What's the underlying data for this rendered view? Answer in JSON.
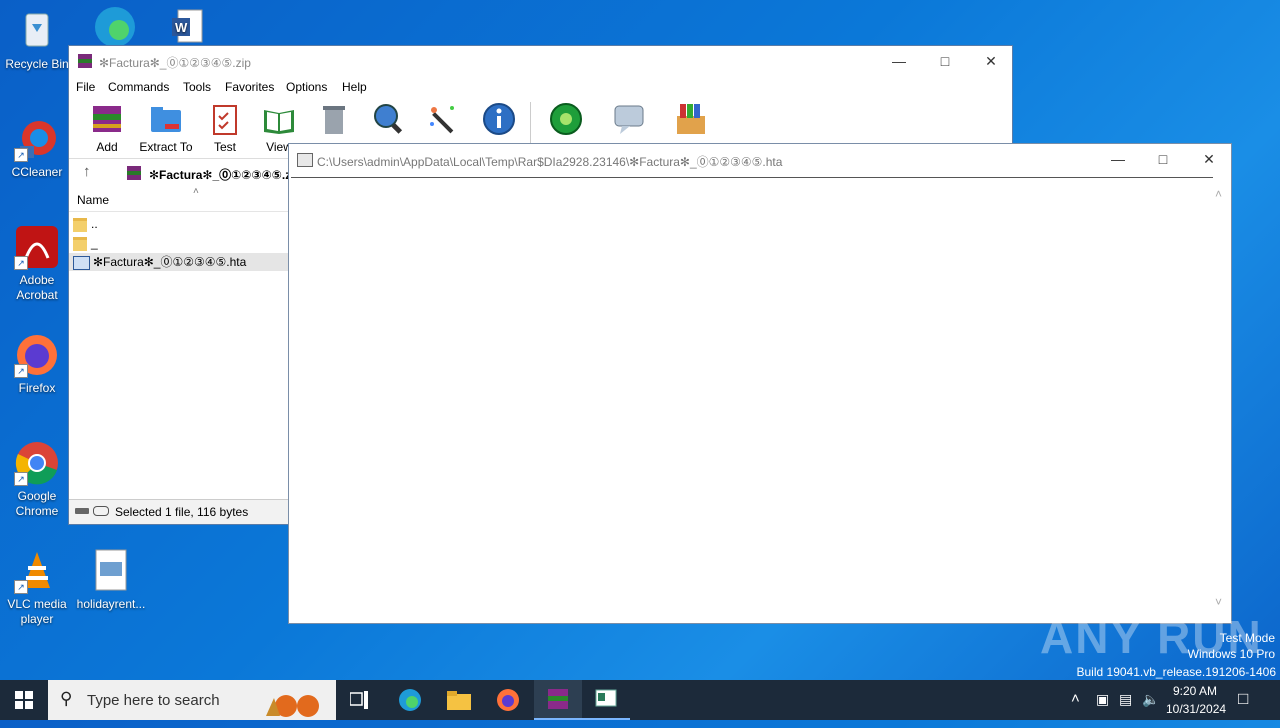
{
  "desktop": {
    "icons": [
      {
        "label": "Recycle Bin",
        "icon": "recycle-bin-icon"
      },
      {
        "label": "CCleaner",
        "icon": "ccleaner-icon"
      },
      {
        "label": "Adobe Acrobat",
        "icon": "acrobat-icon"
      },
      {
        "label": "Firefox",
        "icon": "firefox-icon"
      },
      {
        "label": "Google Chrome",
        "icon": "chrome-icon"
      },
      {
        "label": "VLC media player",
        "icon": "vlc-icon"
      },
      {
        "label": "holidayrent...",
        "icon": "file-icon"
      }
    ]
  },
  "winrar": {
    "title": "✻Factura✻_⓪①②③④⑤.zip",
    "menu": [
      "File",
      "Commands",
      "Tools",
      "Favorites",
      "Options",
      "Help"
    ],
    "toolbar": [
      "Add",
      "Extract To",
      "Test",
      "View",
      "Delete",
      "Find",
      "Wizard",
      "Info",
      "VirusScan",
      "Comment",
      "SFX"
    ],
    "address": "✻Factura✻_⓪①②③④⑤.z",
    "column_name": "Name",
    "rows": [
      "..",
      "_",
      "✻Factura✻_⓪①②③④⑤.hta"
    ],
    "status": "Selected 1 file, 116 bytes"
  },
  "hta": {
    "title": "C:\\Users\\admin\\AppData\\Local\\Temp\\Rar$DIa2928.23146\\✻Factura✻_⓪①②③④⑤.hta"
  },
  "watermark": {
    "brand": "ANY RUN",
    "line1": "Test Mode",
    "line2": "Windows 10 Pro",
    "line3": "Build 19041.vb_release.191206-1406"
  },
  "taskbar": {
    "search_placeholder": "Type here to search",
    "time": "9:20 AM",
    "date": "10/31/2024"
  },
  "colors": {
    "desktop": "#0b78d8",
    "taskbar": "#1c2a3a",
    "accent": "#1a5fb4"
  }
}
